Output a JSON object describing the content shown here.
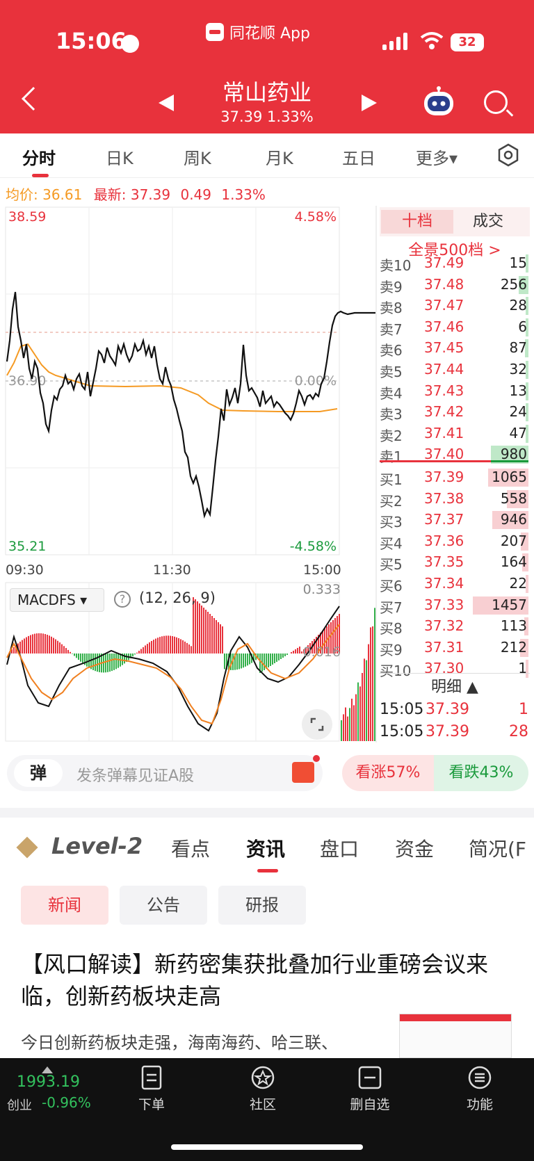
{
  "status": {
    "time": "15:06",
    "app": "同花顺 App",
    "battery": "32"
  },
  "header": {
    "name": "常山药业",
    "price_line": "37.39  1.33%"
  },
  "tabs": [
    "分时",
    "日K",
    "周K",
    "月K",
    "五日",
    "更多▾"
  ],
  "info": {
    "avg_label": "均价: ",
    "avg": "36.61",
    "latest_label": "最新: ",
    "latest": "37.39",
    "chg": "0.49",
    "pct": "1.33%"
  },
  "chart": {
    "high": "38.59",
    "high_pct": "4.58%",
    "low": "35.21",
    "low_pct": "-4.58%",
    "mid": "36.90",
    "mid_pct": "0.00%",
    "t0": "09:30",
    "t1": "11:30",
    "t2": "15:00"
  },
  "macd": {
    "label": "MACDFS",
    "params": "(12, 26, 9)",
    "top": "0.333",
    "mid": "0.016"
  },
  "orderbook": {
    "tab1": "十档",
    "tab2": "成交",
    "full": "全景500档 >",
    "asks": [
      [
        "卖10",
        "37.49",
        "15"
      ],
      [
        "卖9",
        "37.48",
        "256"
      ],
      [
        "卖8",
        "37.47",
        "28"
      ],
      [
        "卖7",
        "37.46",
        "6"
      ],
      [
        "卖6",
        "37.45",
        "87"
      ],
      [
        "卖5",
        "37.44",
        "32"
      ],
      [
        "卖4",
        "37.43",
        "13"
      ],
      [
        "卖3",
        "37.42",
        "24"
      ],
      [
        "卖2",
        "37.41",
        "47"
      ],
      [
        "卖1",
        "37.40",
        "980"
      ]
    ],
    "bids": [
      [
        "买1",
        "37.39",
        "1065"
      ],
      [
        "买2",
        "37.38",
        "558"
      ],
      [
        "买3",
        "37.37",
        "946"
      ],
      [
        "买4",
        "37.36",
        "207"
      ],
      [
        "买5",
        "37.35",
        "164"
      ],
      [
        "买6",
        "37.34",
        "22"
      ],
      [
        "买7",
        "37.33",
        "1457"
      ],
      [
        "买8",
        "37.32",
        "113"
      ],
      [
        "买9",
        "37.31",
        "212"
      ],
      [
        "买10",
        "37.30",
        "1"
      ]
    ],
    "detail": "明细 ▲",
    "trades": [
      [
        "15:05",
        "37.39",
        "1"
      ],
      [
        "15:05",
        "37.39",
        "28"
      ]
    ]
  },
  "danmu": {
    "btn": "弹",
    "placeholder": "发条弹幕见证A股",
    "up": "看涨57%",
    "down": "看跌43%"
  },
  "news_tabs": {
    "level2": "Level-2",
    "items": [
      "看点",
      "资讯",
      "盘口",
      "资金",
      "简况(F"
    ]
  },
  "chips": [
    "新闻",
    "公告",
    "研报"
  ],
  "article": {
    "title": "【风口解读】新药密集获批叠加行业重磅会议来临，创新药板块走高",
    "summary": "今日创新药板块走强，海南海药、哈三联、"
  },
  "bottom": {
    "index_value": "1993.19",
    "index_name": "创业",
    "index_pct": "-0.96%",
    "items": [
      "下单",
      "社区",
      "删自选",
      "功能"
    ]
  },
  "colors": {
    "brand": "#e8323c",
    "up": "#e8323c",
    "down": "#1a9a3c",
    "avg": "#f59a23"
  }
}
